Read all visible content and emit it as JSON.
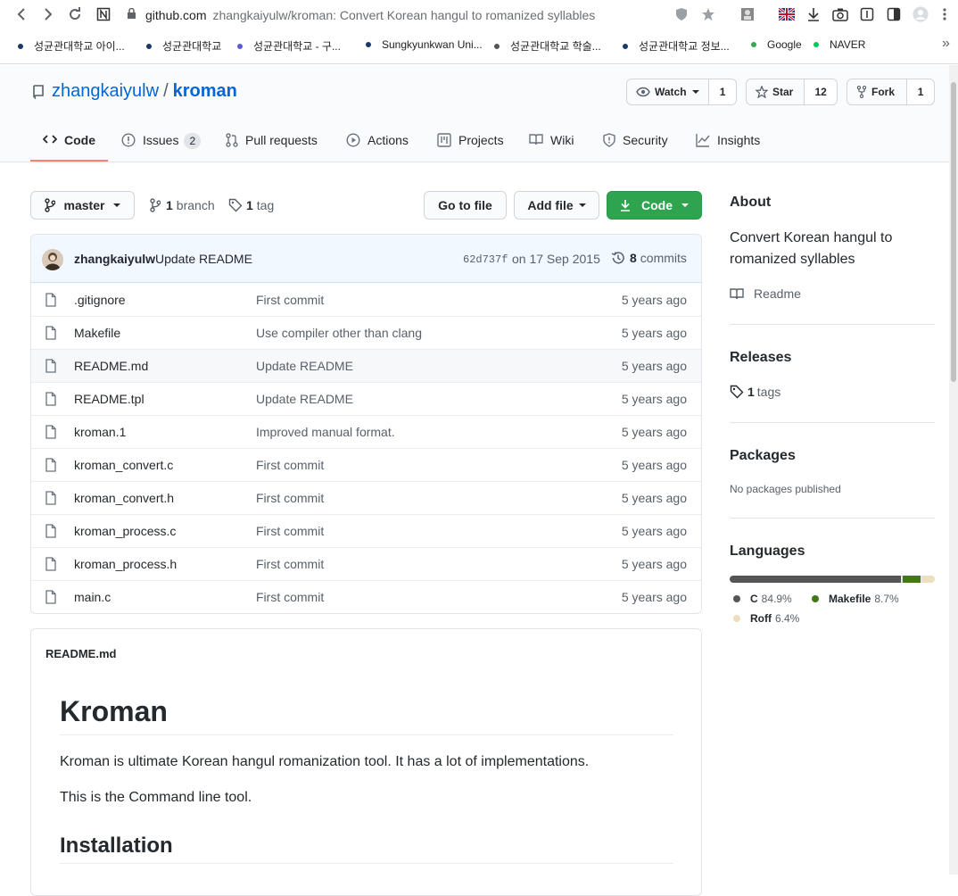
{
  "browser": {
    "url_host": "github.com",
    "url_rest": "zhangkaiyulw/kroman: Convert Korean hangul to romanized syllables",
    "bookmarks": [
      {
        "label": "성균관대학교 아이...",
        "color": "#1a3a6b"
      },
      {
        "label": "성균관대학교",
        "color": "#1a3a6b"
      },
      {
        "label": "성균관대학교 - 구...",
        "color": "#5b5bd6"
      },
      {
        "label": "Sungkyunkwan Uni...",
        "color": "#1a3a6b"
      },
      {
        "label": "성균관대학교 학술...",
        "color": "#555555"
      },
      {
        "label": "성균관대학교 정보...",
        "color": "#1a3a6b"
      },
      {
        "label": "Google",
        "color": "#34a853"
      },
      {
        "label": "NAVER",
        "color": "#03c75a"
      }
    ],
    "more_label": "»"
  },
  "repo": {
    "owner": "zhangkaiyulw",
    "separator": "/",
    "name": "kroman",
    "watch_label": "Watch",
    "watch_count": "1",
    "star_label": "Star",
    "star_count": "12",
    "fork_label": "Fork",
    "fork_count": "1"
  },
  "tabs": [
    {
      "label": "Code",
      "icon": "code-icon"
    },
    {
      "label": "Issues",
      "icon": "issue-icon",
      "count": "2"
    },
    {
      "label": "Pull requests",
      "icon": "pull-request-icon"
    },
    {
      "label": "Actions",
      "icon": "play-icon"
    },
    {
      "label": "Projects",
      "icon": "project-icon"
    },
    {
      "label": "Wiki",
      "icon": "book-icon"
    },
    {
      "label": "Security",
      "icon": "shield-icon"
    },
    {
      "label": "Insights",
      "icon": "graph-icon"
    }
  ],
  "toolbar": {
    "branch": "master",
    "branch_count": "1",
    "branch_word": "branch",
    "tag_count": "1",
    "tag_word": "tag",
    "goto_file": "Go to file",
    "add_file": "Add file",
    "code": "Code"
  },
  "commit": {
    "author": "zhangkaiyulw",
    "message": "Update README",
    "sha": "62d737f",
    "date": "on 17 Sep 2015",
    "count": "8",
    "count_word": "commits"
  },
  "files": [
    {
      "name": ".gitignore",
      "message": "First commit",
      "age": "5 years ago"
    },
    {
      "name": "Makefile",
      "message": "Use compiler other than clang",
      "age": "5 years ago"
    },
    {
      "name": "README.md",
      "message": "Update README",
      "age": "5 years ago"
    },
    {
      "name": "README.tpl",
      "message": "Update README",
      "age": "5 years ago"
    },
    {
      "name": "kroman.1",
      "message": "Improved manual format.",
      "age": "5 years ago"
    },
    {
      "name": "kroman_convert.c",
      "message": "First commit",
      "age": "5 years ago"
    },
    {
      "name": "kroman_convert.h",
      "message": "First commit",
      "age": "5 years ago"
    },
    {
      "name": "kroman_process.c",
      "message": "First commit",
      "age": "5 years ago"
    },
    {
      "name": "kroman_process.h",
      "message": "First commit",
      "age": "5 years ago"
    },
    {
      "name": "main.c",
      "message": "First commit",
      "age": "5 years ago"
    }
  ],
  "readme": {
    "filename": "README.md",
    "h1": "Kroman",
    "p1": "Kroman is ultimate Korean hangul romanization tool. It has a lot of implementations.",
    "p2": "This is the Command line tool.",
    "h2": "Installation"
  },
  "sidebar": {
    "about_title": "About",
    "about_desc": "Convert Korean hangul to romanized syllables",
    "readme_link": "Readme",
    "releases_title": "Releases",
    "tags_count": "1",
    "tags_word": "tags",
    "packages_title": "Packages",
    "packages_text": "No packages published",
    "languages_title": "Languages",
    "languages": [
      {
        "name": "C",
        "percent": "84.9%",
        "value": 84.9,
        "color": "#555555"
      },
      {
        "name": "Makefile",
        "percent": "8.7%",
        "value": 8.7,
        "color": "#427819"
      },
      {
        "name": "Roff",
        "percent": "6.4%",
        "value": 6.4,
        "color": "#ecdebe"
      }
    ]
  }
}
